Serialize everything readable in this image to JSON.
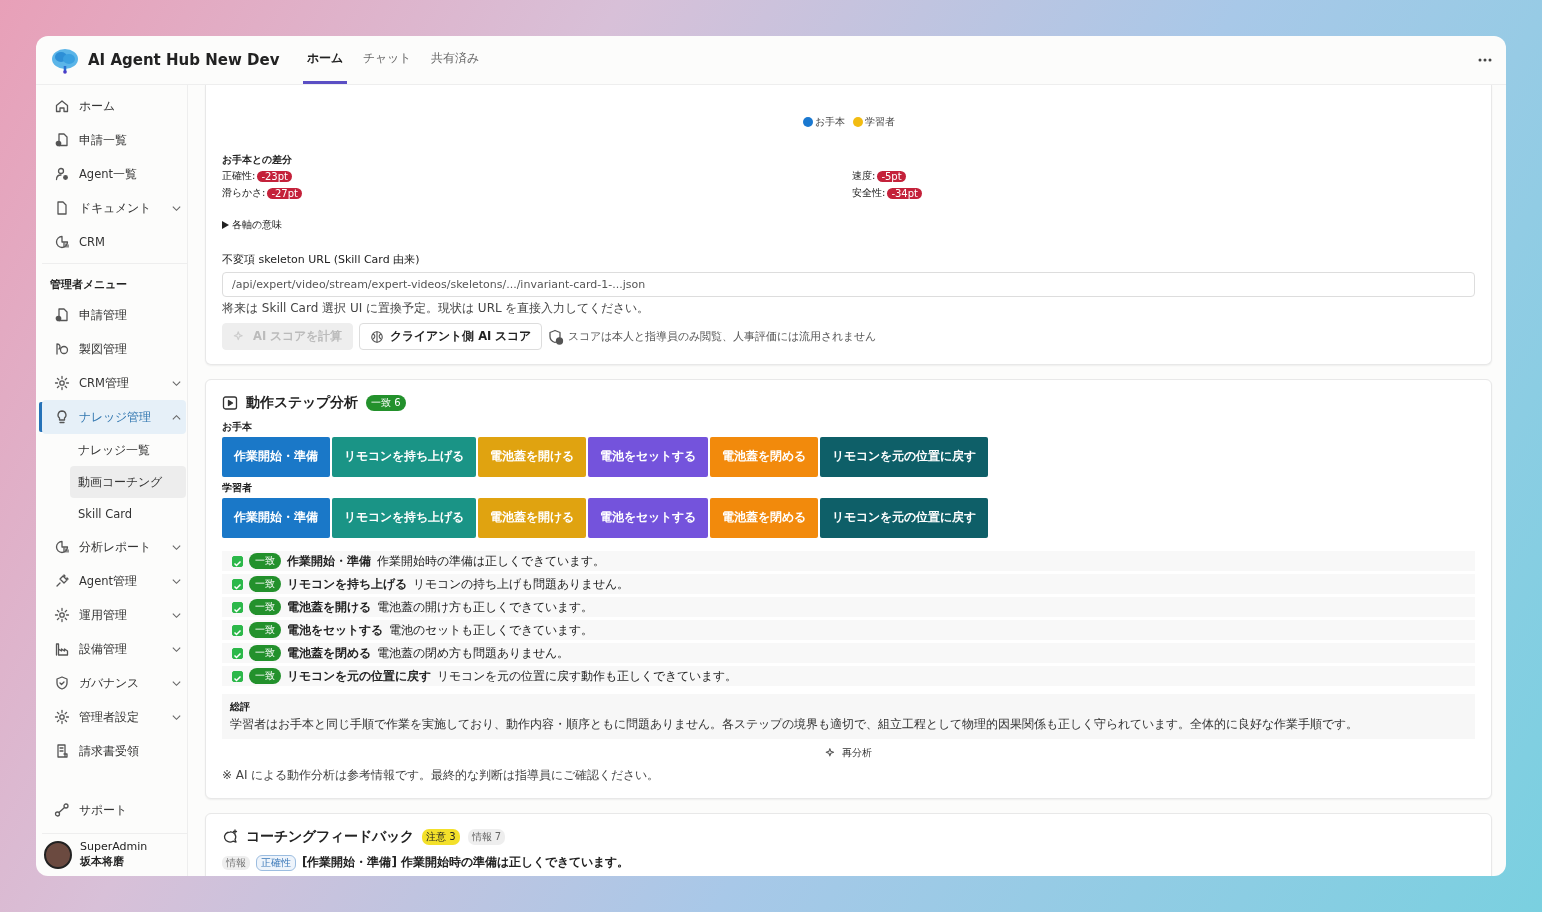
{
  "app": {
    "title": "AI Agent Hub New Dev"
  },
  "tabs": [
    {
      "label": "ホーム",
      "selected": true
    },
    {
      "label": "チャット",
      "selected": false
    },
    {
      "label": "共有済み",
      "selected": false
    }
  ],
  "sidebar": {
    "items": [
      {
        "label": "ホーム",
        "kind": "link",
        "selected": false
      },
      {
        "label": "申請一覧",
        "kind": "link",
        "selected": false
      },
      {
        "label": "Agent一覧",
        "kind": "link",
        "selected": false
      },
      {
        "label": "ドキュメント",
        "kind": "group",
        "selected": false,
        "expanded": false
      },
      {
        "label": "CRM",
        "kind": "link",
        "selected": false
      }
    ],
    "admin_heading": "管理者メニュー",
    "admin_items": [
      {
        "label": "申請管理",
        "kind": "link",
        "selected": false
      },
      {
        "label": "製図管理",
        "kind": "link",
        "selected": false
      },
      {
        "label": "CRM管理",
        "kind": "group",
        "selected": false,
        "expanded": false
      },
      {
        "label": "ナレッジ管理",
        "kind": "group",
        "selected": true,
        "expanded": true,
        "children": [
          {
            "label": "ナレッジ一覧",
            "selected": false
          },
          {
            "label": "動画コーチング",
            "selected": true
          },
          {
            "label": "Skill Card",
            "selected": false
          }
        ]
      },
      {
        "label": "分析レポート",
        "kind": "group",
        "selected": false,
        "expanded": false
      },
      {
        "label": "Agent管理",
        "kind": "group",
        "selected": false,
        "expanded": false
      },
      {
        "label": "運用管理",
        "kind": "group",
        "selected": false,
        "expanded": false
      },
      {
        "label": "設備管理",
        "kind": "group",
        "selected": false,
        "expanded": false
      },
      {
        "label": "ガバナンス",
        "kind": "group",
        "selected": false,
        "expanded": false
      },
      {
        "label": "管理者設定",
        "kind": "group",
        "selected": false,
        "expanded": false
      },
      {
        "label": "請求書受領",
        "kind": "link",
        "selected": false
      }
    ],
    "support": "サポート",
    "user": {
      "role": "SuperAdmin",
      "name": "坂本将磨"
    }
  },
  "score_card": {
    "legend": [
      {
        "label": "お手本",
        "color": "#1a78d0"
      },
      {
        "label": "学習者",
        "color": "#f2bc12"
      }
    ],
    "diff_heading": "お手本との差分",
    "metrics": [
      {
        "label": "正確性:",
        "value": "-23pt"
      },
      {
        "label": "速度:",
        "value": "-5pt"
      },
      {
        "label": "滑らかさ:",
        "value": "-27pt"
      },
      {
        "label": "安全性:",
        "value": "-34pt"
      }
    ],
    "details": {
      "label": "各軸の意味",
      "expanded": false
    },
    "url_label": "不変項 skeleton URL (Skill Card 由来)",
    "url_value": "/api/expert/video/stream/expert-videos/skeletons/.../invariant-card-1-...json",
    "url_hint": "将来は Skill Card 選択 UI に置換予定。現状は URL を直接入力してください。",
    "buttons": [
      {
        "label": "AI スコアを計算",
        "disabled": true
      },
      {
        "label": "クライアント側 AI スコア",
        "disabled": false
      }
    ],
    "privacy_note": "スコアは本人と指導員のみ閲覧、人事評価には流用されません"
  },
  "step_card": {
    "title": "動作ステップ分析",
    "badge": "一致 6",
    "timelines": [
      {
        "label": "お手本",
        "segments": [
          {
            "label": "作業開始・準備",
            "color": "#1a78c8"
          },
          {
            "label": "リモコンを持ち上げる",
            "color": "#1a9486"
          },
          {
            "label": "電池蓋を開ける",
            "color": "#e0a310"
          },
          {
            "label": "電池をセットする",
            "color": "#7453dc"
          },
          {
            "label": "電池蓋を閉める",
            "color": "#f28a0c"
          },
          {
            "label": "リモコンを元の位置に戻す",
            "color": "#0e5f68"
          }
        ]
      },
      {
        "label": "学習者",
        "segments": [
          {
            "label": "作業開始・準備",
            "color": "#1a78c8"
          },
          {
            "label": "リモコンを持ち上げる",
            "color": "#1a9486"
          },
          {
            "label": "電池蓋を開ける",
            "color": "#e0a310"
          },
          {
            "label": "電池をセットする",
            "color": "#7453dc"
          },
          {
            "label": "電池蓋を閉める",
            "color": "#f28a0c"
          },
          {
            "label": "リモコンを元の位置に戻す",
            "color": "#0e5f68"
          }
        ]
      }
    ],
    "steps": [
      {
        "checked": true,
        "status": "一致",
        "name": "作業開始・準備",
        "comment": "作業開始時の準備は正しくできています。"
      },
      {
        "checked": true,
        "status": "一致",
        "name": "リモコンを持ち上げる",
        "comment": "リモコンの持ち上げも問題ありません。"
      },
      {
        "checked": true,
        "status": "一致",
        "name": "電池蓋を開ける",
        "comment": "電池蓋の開け方も正しくできています。"
      },
      {
        "checked": true,
        "status": "一致",
        "name": "電池をセットする",
        "comment": "電池のセットも正しくできています。"
      },
      {
        "checked": true,
        "status": "一致",
        "name": "電池蓋を閉める",
        "comment": "電池蓋の閉め方も問題ありません。"
      },
      {
        "checked": true,
        "status": "一致",
        "name": "リモコンを元の位置に戻す",
        "comment": "リモコンを元の位置に戻す動作も正しくできています。"
      }
    ],
    "summary_heading": "総評",
    "summary": "学習者はお手本と同じ手順で作業を実施しており、動作内容・順序ともに問題ありません。各ステップの境界も適切で、組立工程として物理的因果関係も正しく守られています。全体的に良好な作業手順です。",
    "reanalyze": "再分析",
    "footnote": "※ AI による動作分析は参考情報です。最終的な判断は指導員にご確認ください。"
  },
  "feedback_card": {
    "title": "コーチングフィードバック",
    "badges": [
      {
        "label": "注意 3",
        "kind": "warning"
      },
      {
        "label": "情報 7",
        "kind": "info"
      }
    ],
    "items": [
      {
        "level": "情報",
        "axis": "正確性",
        "text": "[作業開始・準備] 作業開始時の準備は正しくできています。"
      }
    ]
  }
}
